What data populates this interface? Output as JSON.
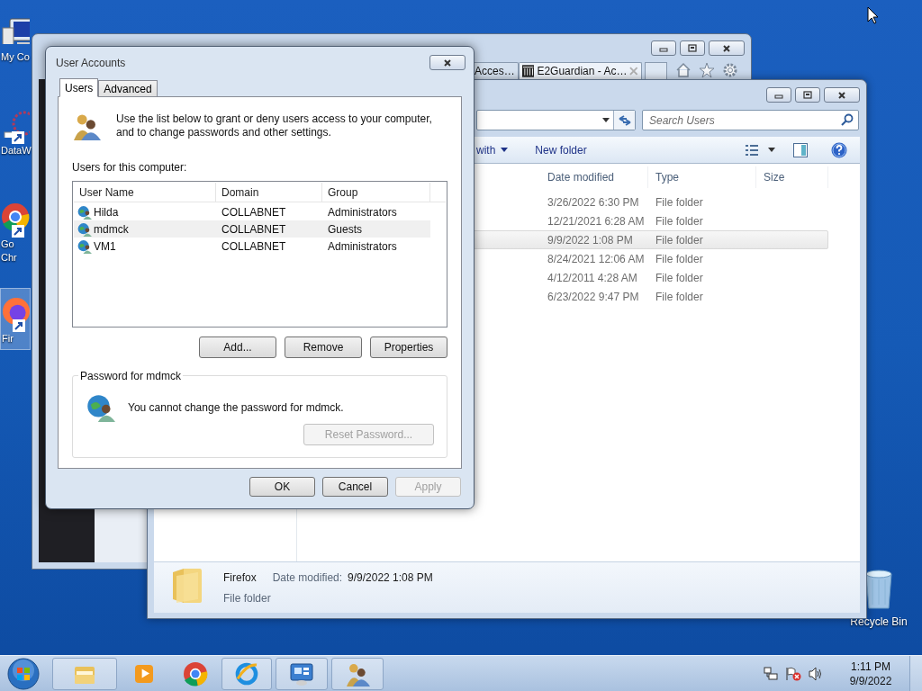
{
  "desktop": {
    "icons": [
      {
        "kind": "computer",
        "lines": [
          "My Co"
        ],
        "selected": false
      },
      {
        "kind": "shortcut",
        "lines": [
          "DataW"
        ],
        "selected": false
      },
      {
        "kind": "chrome",
        "lines": [
          "Go",
          "Chr"
        ],
        "selected": false
      },
      {
        "kind": "firefox",
        "lines": [
          "Fir"
        ],
        "selected": true
      }
    ],
    "recycle_bin": {
      "label": "Recycle Bin"
    }
  },
  "browser": {
    "tabs": [
      {
        "label": "Acces…",
        "selected": false
      },
      {
        "label": "E2Guardian - Ac…",
        "selected": true
      }
    ]
  },
  "explorer": {
    "search": {
      "placeholder": "Search Users"
    },
    "toolbar": [
      "with",
      "New folder"
    ],
    "columns": [
      "Date modified",
      "Type",
      "Size"
    ],
    "rows": [
      {
        "date": "3/26/2022 6:30 PM",
        "type": "File folder",
        "selected": false
      },
      {
        "date": "12/21/2021 6:28 AM",
        "type": "File folder",
        "selected": false
      },
      {
        "date": "9/9/2022 1:08 PM",
        "type": "File folder",
        "selected": true
      },
      {
        "date": "8/24/2021 12:06 AM",
        "type": "File folder",
        "selected": false
      },
      {
        "date": "4/12/2011 4:28 AM",
        "type": "File folder",
        "selected": false
      },
      {
        "date": "6/23/2022 9:47 PM",
        "type": "File folder",
        "selected": false
      }
    ],
    "details": {
      "name": "Firefox",
      "type": "File folder",
      "date_label": "Date modified:",
      "date": "9/9/2022 1:08 PM"
    }
  },
  "dialog": {
    "title": "User Accounts",
    "tabs": [
      {
        "label": "Users",
        "selected": true
      },
      {
        "label": "Advanced",
        "selected": false
      }
    ],
    "intro_lines": [
      "Use the list below to grant or deny users access to your computer,",
      "and to change passwords and other settings."
    ],
    "list_label": "Users for this computer:",
    "columns": [
      "User Name",
      "Domain",
      "Group"
    ],
    "users": [
      {
        "name": "Hilda",
        "domain": "COLLABNET",
        "group": "Administrators",
        "selected": false
      },
      {
        "name": "mdmck",
        "domain": "COLLABNET",
        "group": "Guests",
        "selected": true
      },
      {
        "name": "VM1",
        "domain": "COLLABNET",
        "group": "Administrators",
        "selected": false
      }
    ],
    "list_buttons": [
      "Add...",
      "Remove",
      "Properties"
    ],
    "password": {
      "title": "Password for mdmck",
      "message": "You cannot change the password for mdmck.",
      "reset": {
        "label": "Reset Password...",
        "disabled": true
      }
    },
    "footer_buttons": [
      {
        "label": "OK",
        "disabled": false
      },
      {
        "label": "Cancel",
        "disabled": false
      },
      {
        "label": "Apply",
        "disabled": true
      }
    ]
  },
  "taskbar": {
    "items": [
      {
        "kind": "explorer",
        "open": true
      },
      {
        "kind": "media",
        "open": false
      },
      {
        "kind": "chrome",
        "open": false
      },
      {
        "kind": "ie",
        "open": true
      },
      {
        "kind": "control_panel",
        "open": true
      },
      {
        "kind": "users",
        "open": true
      }
    ],
    "clock": {
      "time": "1:11 PM",
      "date": "9/9/2022"
    }
  }
}
